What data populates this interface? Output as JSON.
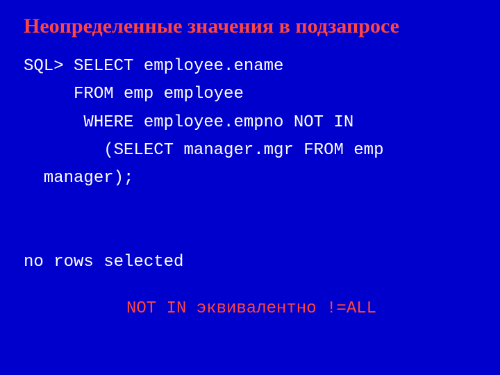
{
  "title": "Неопределенные значения в подзапросе",
  "code_line1": "SQL> SELECT employee.ename",
  "code_line2": "     FROM emp employee",
  "code_line3": "      WHERE employee.empno NOT IN",
  "code_line4": "        (SELECT manager.mgr FROM emp",
  "code_line5": "  manager);",
  "code_blank1": "",
  "code_blank2": "",
  "code_result": "no rows selected",
  "footnote": "NOT IN эквивалентно !=ALL"
}
